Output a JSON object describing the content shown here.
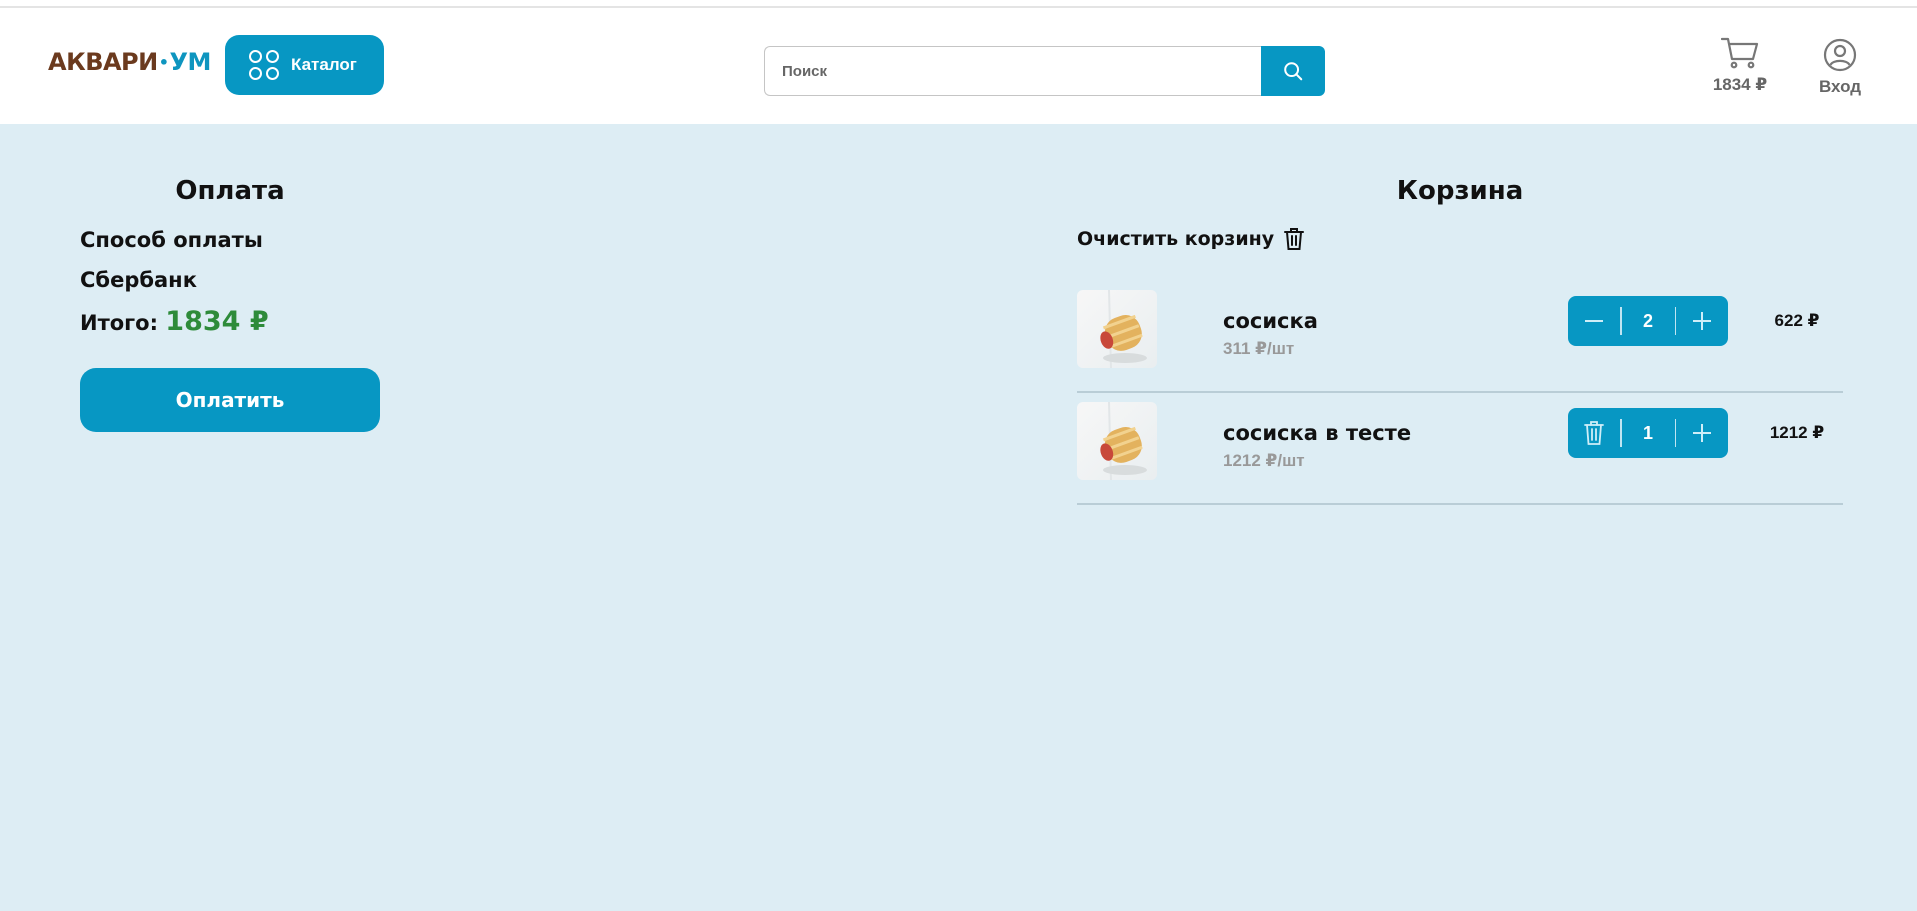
{
  "header": {
    "logo_left": "АКВАРИ",
    "logo_right": "УМ",
    "catalog_label": "Каталог",
    "search_placeholder": "Поиск",
    "cart_sum": "1834 ₽",
    "login_label": "Вход"
  },
  "payment": {
    "title": "Оплата",
    "method_label": "Способ оплаты",
    "method_value": "Сбербанк",
    "total_label": "Итого:",
    "total_value": "1834 ₽",
    "pay_button": "Оплатить"
  },
  "cart": {
    "title": "Корзина",
    "clear_label": "Очистить корзину",
    "items": [
      {
        "name": "сосиска",
        "unit_price": "311 ₽/шт",
        "quantity": "2",
        "price": "622 ₽",
        "left_control": "minus-icon"
      },
      {
        "name": "сосиска в тесте",
        "unit_price": "1212 ₽/шт",
        "quantity": "1",
        "price": "1212 ₽",
        "left_control": "trash-icon"
      }
    ]
  },
  "colors": {
    "accent": "#0797c3",
    "background": "#ddedf4",
    "total_green": "#2e8b3a",
    "logo_brown": "#6b3a1e"
  }
}
